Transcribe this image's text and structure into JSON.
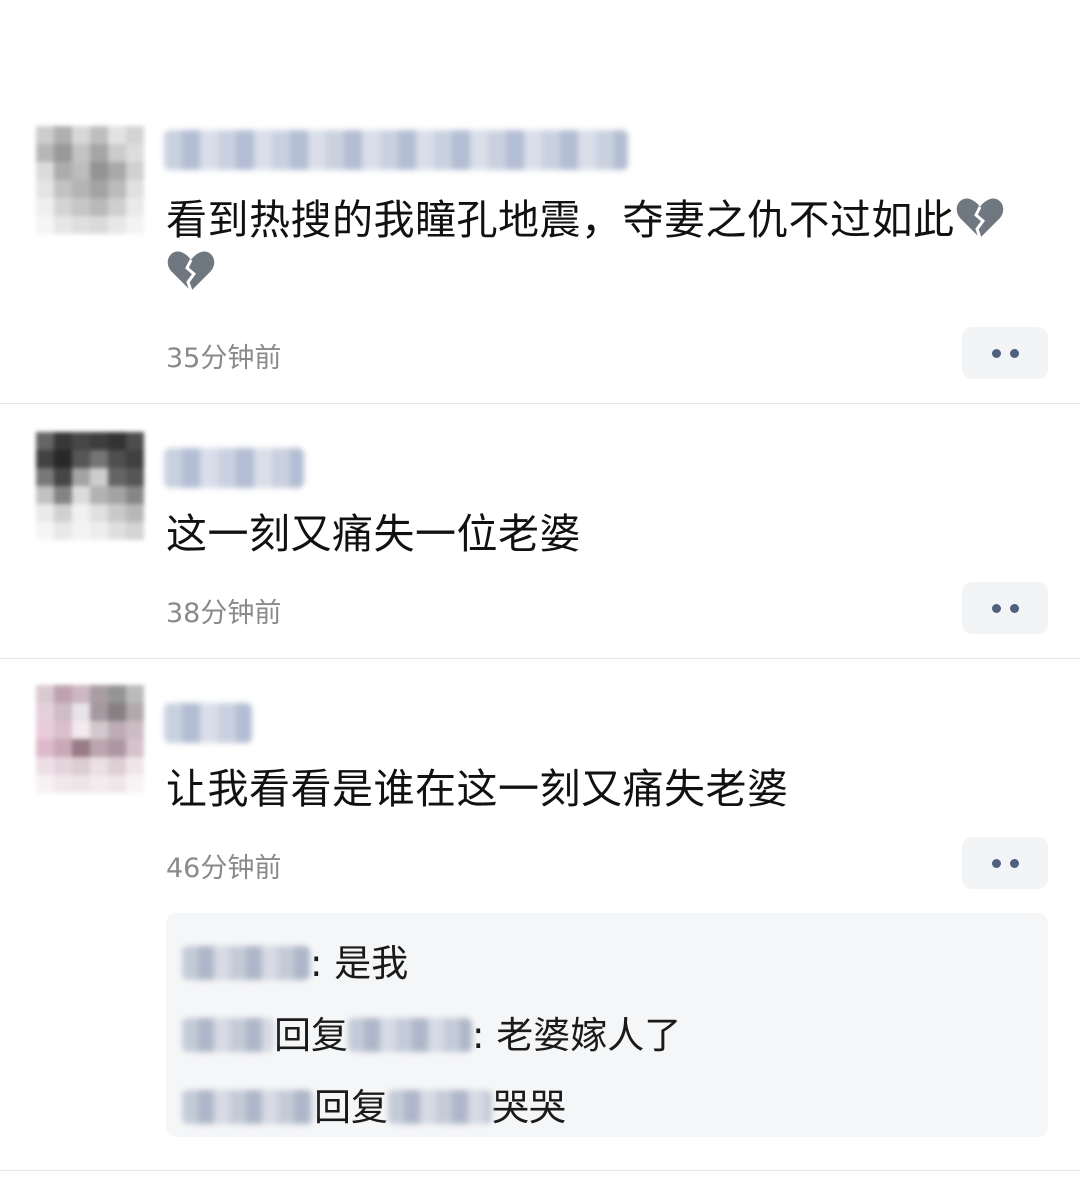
{
  "comments": [
    {
      "text": "看到热搜的我瞳孔地震，夺妻之仇不过如此",
      "emoji": [
        "broken-heart",
        "broken-heart"
      ],
      "time": "35分钟前"
    },
    {
      "text": "这一刻又痛失一位老婆",
      "time": "38分钟前"
    },
    {
      "text": "让我看看是谁在这一刻又痛失老婆",
      "time": "46分钟前",
      "replies": [
        {
          "sep": ":",
          "text": "是我"
        },
        {
          "reply_word": "回复",
          "sep": ":",
          "text": "老婆嫁人了"
        },
        {
          "reply_word": "回复",
          "text": "哭哭"
        }
      ]
    }
  ],
  "colors": {
    "more_dots": "#506080",
    "time_text": "#8a8a8a",
    "reply_bg": "#f5f6f7"
  }
}
